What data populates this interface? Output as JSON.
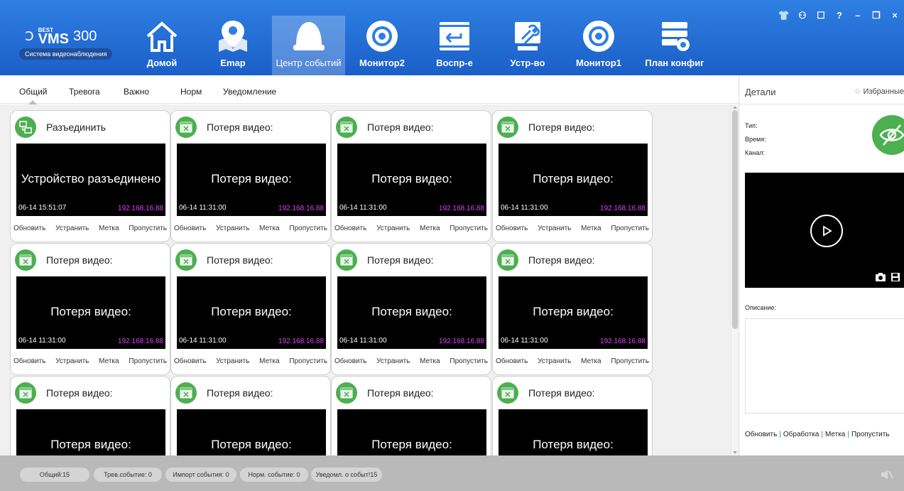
{
  "app": {
    "logo_best": "BEST",
    "logo_vms": "VMS",
    "logo_version": "300",
    "logo_subtitle": "Система видеонаблюдения"
  },
  "nav": [
    {
      "label": "Домой",
      "icon": "home-icon"
    },
    {
      "label": "Emap",
      "icon": "map-pin-icon"
    },
    {
      "label": "Центр событий",
      "icon": "alarm-light-icon",
      "active": true
    },
    {
      "label": "Монитор2",
      "icon": "camera-lens-icon"
    },
    {
      "label": "Воспр-е",
      "icon": "playback-icon"
    },
    {
      "label": "Устр-во",
      "icon": "wrench-icon"
    },
    {
      "label": "Монитор1",
      "icon": "camera-lens-icon"
    },
    {
      "label": "План конфиг",
      "icon": "config-plan-icon"
    }
  ],
  "tabs": [
    "Общий",
    "Тревога",
    "Важно",
    "Норм",
    "Уведомление"
  ],
  "cards": [
    {
      "title": "Разъединить",
      "message": "Устройство разъединено",
      "time": "06-14 15:51:07",
      "ip": "192.168.16.88",
      "icon": "disconnect-icon"
    },
    {
      "title": "Потеря видео:",
      "message": "Потеря видео:",
      "time": "06-14 11:31:00",
      "ip": "192.168.16.88",
      "icon": "video-loss-icon"
    },
    {
      "title": "Потеря видео:",
      "message": "Потеря видео:",
      "time": "06-14 11:31:00",
      "ip": "192.168.16.88",
      "icon": "video-loss-icon"
    },
    {
      "title": "Потеря видео:",
      "message": "Потеря видео:",
      "time": "06-14 11:31:00",
      "ip": "192.168.16.88",
      "icon": "video-loss-icon"
    },
    {
      "title": "Потеря видео:",
      "message": "Потеря видео:",
      "time": "06-14 11:31:00",
      "ip": "192.168.16.88",
      "icon": "video-loss-icon"
    },
    {
      "title": "Потеря видео:",
      "message": "Потеря видео:",
      "time": "06-14 11:31:00",
      "ip": "192.168.16.88",
      "icon": "video-loss-icon"
    },
    {
      "title": "Потеря видео:",
      "message": "Потеря видео:",
      "time": "06-14 11:31:00",
      "ip": "192.168.16.88",
      "icon": "video-loss-icon"
    },
    {
      "title": "Потеря видео:",
      "message": "Потеря видео:",
      "time": "06-14 11:31:00",
      "ip": "192.168.16.88",
      "icon": "video-loss-icon"
    },
    {
      "title": "Потеря видео:",
      "message": "Потеря видео:",
      "time": "",
      "ip": "",
      "icon": "video-loss-icon"
    },
    {
      "title": "Потеря видео:",
      "message": "Потеря видео:",
      "time": "",
      "ip": "",
      "icon": "video-loss-icon"
    },
    {
      "title": "Потеря видео:",
      "message": "Потеря видео:",
      "time": "",
      "ip": "",
      "icon": "video-loss-icon"
    },
    {
      "title": "Потеря видео:",
      "message": "Потеря видео:",
      "time": "",
      "ip": "",
      "icon": "video-loss-icon"
    }
  ],
  "card_actions": [
    "Обновить",
    "Устранить",
    "Метка",
    "Пропустить"
  ],
  "details": {
    "title": "Детали",
    "favorite": "Избранные",
    "type_label": "Тип:",
    "time_label": "Время:",
    "channel_label": "Канал:",
    "description_label": "Описание:",
    "actions": [
      "Обновить",
      "Обработка",
      "Метка",
      "Пропустить"
    ]
  },
  "status": {
    "total": "Общий:15",
    "alarm": "Трев.событие: 0",
    "important": "Импорт события: 0",
    "normal": "Норм. событие: 0",
    "notify": "Уведомл. о событ!15"
  },
  "window_controls": [
    "shirt-icon",
    "user-icon",
    "lock-icon",
    "help-icon",
    "minimize-icon",
    "restore-icon",
    "close-icon"
  ],
  "colors": {
    "topbar": "#2f7fe2",
    "accent_green": "#4caf50",
    "ip_text": "#e040fb"
  }
}
